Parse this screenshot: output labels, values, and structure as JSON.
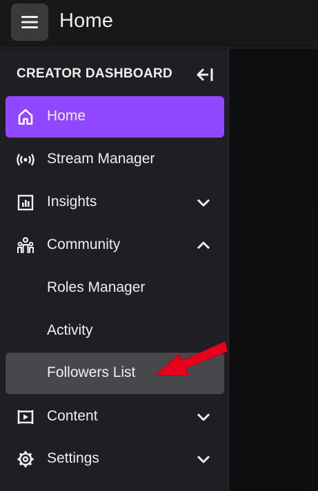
{
  "header": {
    "title": "Home",
    "menu_icon": "hamburger-menu-icon"
  },
  "sidebar": {
    "section_title": "CREATOR DASHBOARD",
    "collapse_icon": "collapse-left-icon",
    "items": [
      {
        "label": "Home",
        "icon": "home-icon",
        "state": "active"
      },
      {
        "label": "Stream Manager",
        "icon": "broadcast-icon"
      },
      {
        "label": "Insights",
        "icon": "insights-chart-icon",
        "chevron": "down"
      },
      {
        "label": "Community",
        "icon": "community-icon",
        "chevron": "up"
      },
      {
        "label": "Roles Manager",
        "sub": true
      },
      {
        "label": "Activity",
        "sub": true
      },
      {
        "label": "Followers List",
        "sub": true,
        "state": "selected"
      },
      {
        "label": "Content",
        "icon": "content-icon",
        "chevron": "down"
      },
      {
        "label": "Settings",
        "icon": "gear-icon",
        "chevron": "down"
      }
    ]
  },
  "colors": {
    "accent": "#9147ff",
    "selected": "#48484c",
    "annotation_arrow": "#e8001c"
  }
}
